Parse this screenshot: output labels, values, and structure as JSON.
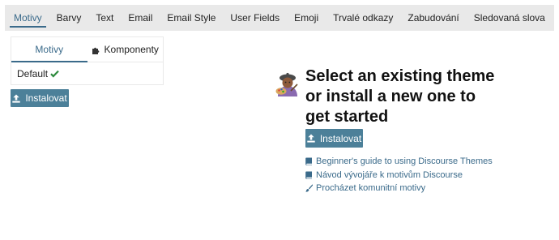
{
  "nav": {
    "tabs": [
      {
        "label": "Motivy",
        "active": true
      },
      {
        "label": "Barvy"
      },
      {
        "label": "Text"
      },
      {
        "label": "Email"
      },
      {
        "label": "Email Style"
      },
      {
        "label": "User Fields"
      },
      {
        "label": "Emoji"
      },
      {
        "label": "Trvalé odkazy"
      },
      {
        "label": "Zabudování"
      },
      {
        "label": "Sledovaná slova"
      }
    ]
  },
  "themes_panel": {
    "tabs": {
      "themes": "Motivy",
      "components": "Komponenty"
    },
    "items": [
      {
        "name": "Default",
        "selected": true
      }
    ],
    "install_label": "Instalovat"
  },
  "empty_state": {
    "emoji": "artist-emoji",
    "headline": "Select an existing theme or install a new one to get started",
    "install_label": "Instalovat",
    "links": [
      {
        "icon": "book-icon",
        "text": "Beginner's guide to using Discourse Themes"
      },
      {
        "icon": "book-icon",
        "text": "Návod vývojáře k motivům Discourse"
      },
      {
        "icon": "paintbrush-icon",
        "text": "Procházet komunitní motivy"
      }
    ]
  },
  "colors": {
    "accent": "#3a6a8a",
    "button": "#4c8099",
    "nav_bg": "#e9e9e9",
    "success": "#2e8b3d"
  }
}
